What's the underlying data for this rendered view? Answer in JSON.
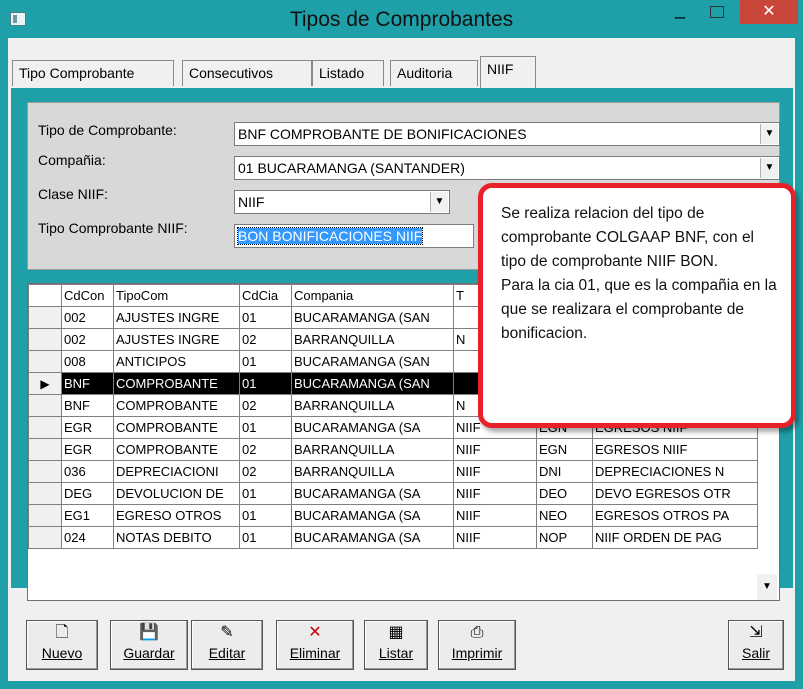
{
  "window": {
    "title": "Tipos de Comprobantes"
  },
  "tabs": [
    {
      "label": "Tipo Comprobante"
    },
    {
      "label": "Consecutivos"
    },
    {
      "label": "Listado"
    },
    {
      "label": "Auditoria"
    },
    {
      "label": "NIIF",
      "active": true
    }
  ],
  "form": {
    "tipo_label": "Tipo de Comprobante:",
    "tipo_value": "BNF  COMPROBANTE DE BONIFICACIONES",
    "compania_label": "Compañia:",
    "compania_value": "01 BUCARAMANGA  (SANTANDER)",
    "clase_label": "Clase NIIF:",
    "clase_value": "NIIF",
    "tipo_niif_label": "Tipo Comprobante NIIF:",
    "tipo_niif_value": "BON  BONIFICACIONES NIIF"
  },
  "grid": {
    "columns": [
      "CdCon",
      "TipoCom",
      "CdCia",
      "Compania",
      "T",
      "",
      ""
    ],
    "rows": [
      [
        "002",
        "AJUSTES INGRE",
        "01",
        "BUCARAMANGA  (SAN",
        "",
        "",
        ""
      ],
      [
        "002",
        "AJUSTES INGRE",
        "02",
        "BARRANQUILLA",
        "N",
        "",
        ""
      ],
      [
        "008",
        "ANTICIPOS",
        "01",
        "BUCARAMANGA  (SAN",
        "",
        "",
        ""
      ],
      [
        "BNF",
        "COMPROBANTE",
        "01",
        "BUCARAMANGA  (SAN",
        "",
        "",
        ""
      ],
      [
        "BNF",
        "COMPROBANTE",
        "02",
        "BARRANQUILLA",
        "N",
        "",
        ""
      ],
      [
        "EGR",
        "COMPROBANTE",
        "01",
        "BUCARAMANGA  (SA",
        "NIIF",
        "EGN",
        "EGRESOS NIIF"
      ],
      [
        "EGR",
        "COMPROBANTE",
        "02",
        "BARRANQUILLA",
        "NIIF",
        "EGN",
        "EGRESOS NIIF"
      ],
      [
        "036",
        "DEPRECIACIONI",
        "02",
        "BARRANQUILLA",
        "NIIF",
        "DNI",
        "DEPRECIACIONES N"
      ],
      [
        "DEG",
        "DEVOLUCION DE",
        "01",
        "BUCARAMANGA  (SA",
        "NIIF",
        "DEO",
        "DEVO EGRESOS OTR"
      ],
      [
        "EG1",
        "EGRESO OTROS",
        "01",
        "BUCARAMANGA  (SA",
        "NIIF",
        "NEO",
        "EGRESOS OTROS PA"
      ],
      [
        "024",
        "NOTAS DEBITO",
        "01",
        "BUCARAMANGA  (SA",
        "NIIF",
        "NOP",
        "NIIF ORDEN DE PAG"
      ]
    ],
    "selected_row": 3
  },
  "callout": {
    "text": "Se realiza relacion del tipo de comprobante COLGAAP BNF, con el tipo de comprobante NIIF BON.\nPara la cia 01, que es la compañia en la que se realizara el comprobante de bonificacion."
  },
  "toolbar": {
    "nuevo": "Nuevo",
    "guardar": "Guardar",
    "editar": "Editar",
    "eliminar": "Eliminar",
    "listar": "Listar",
    "imprimir": "Imprimir",
    "salir": "Salir"
  },
  "colors": {
    "frame": "#1fa0a8",
    "callout_border": "#e8202a",
    "selection": "#3399ff"
  }
}
